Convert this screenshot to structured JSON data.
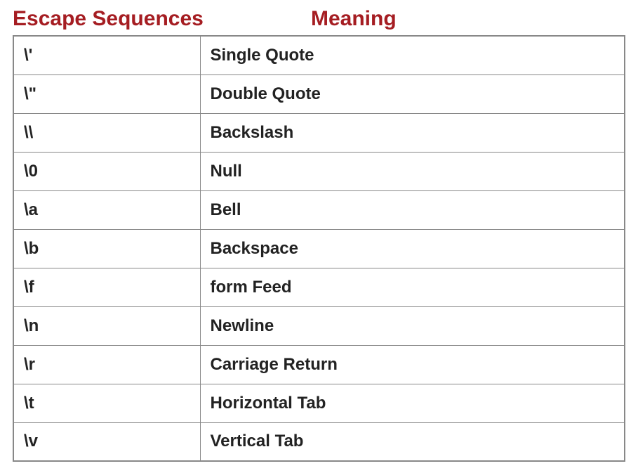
{
  "headers": {
    "col1": "Escape Sequences",
    "col2": "Meaning"
  },
  "rows": [
    {
      "sequence": "\\'",
      "meaning": "Single Quote"
    },
    {
      "sequence": "\\\"",
      "meaning": "Double Quote"
    },
    {
      "sequence": "\\\\",
      "meaning": "Backslash"
    },
    {
      "sequence": "\\0",
      "meaning": "Null"
    },
    {
      "sequence": "\\a",
      "meaning": "Bell"
    },
    {
      "sequence": "\\b",
      "meaning": "Backspace"
    },
    {
      "sequence": "\\f",
      "meaning": "form Feed"
    },
    {
      "sequence": "\\n",
      "meaning": "Newline"
    },
    {
      "sequence": "\\r",
      "meaning": "Carriage Return"
    },
    {
      "sequence": "\\t",
      "meaning": "Horizontal Tab"
    },
    {
      "sequence": "\\v",
      "meaning": "Vertical Tab"
    }
  ],
  "chart_data": {
    "type": "table",
    "columns": [
      "Escape Sequences",
      "Meaning"
    ],
    "rows": [
      [
        "\\'",
        "Single Quote"
      ],
      [
        "\\\"",
        "Double Quote"
      ],
      [
        "\\\\",
        "Backslash"
      ],
      [
        "\\0",
        "Null"
      ],
      [
        "\\a",
        "Bell"
      ],
      [
        "\\b",
        "Backspace"
      ],
      [
        "\\f",
        "form Feed"
      ],
      [
        "\\n",
        "Newline"
      ],
      [
        "\\r",
        "Carriage Return"
      ],
      [
        "\\t",
        "Horizontal Tab"
      ],
      [
        "\\v",
        "Vertical Tab"
      ]
    ]
  }
}
